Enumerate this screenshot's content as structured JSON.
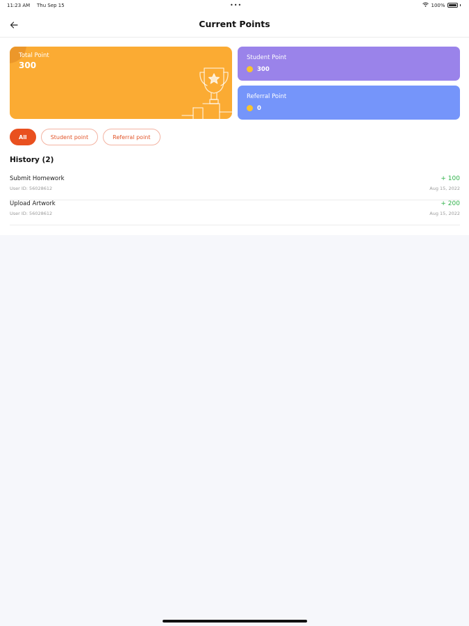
{
  "status_bar": {
    "time": "11:23 AM",
    "date": "Thu Sep 15",
    "dots": "•••",
    "battery": "100%"
  },
  "header": {
    "title": "Current Points",
    "back_icon": "arrow-left-icon"
  },
  "cards": {
    "total": {
      "label": "Total Point",
      "value": "300",
      "color": "#fbab33",
      "icon": "trophy-icon"
    },
    "student": {
      "label": "Student Point",
      "value": "300",
      "color": "#9a83ea",
      "icon": "coin-icon"
    },
    "referral": {
      "label": "Referral Point",
      "value": "0",
      "color": "#7595fa",
      "icon": "coin-icon"
    }
  },
  "filters": [
    {
      "label": "All",
      "active": true
    },
    {
      "label": "Student point",
      "active": false
    },
    {
      "label": "Referral point",
      "active": false
    }
  ],
  "history": {
    "title": "History (2)",
    "items": [
      {
        "name": "Submit Homework",
        "user_id": "User ID: 56028612",
        "points": "+ 100",
        "date": "Aug 15, 2022"
      },
      {
        "name": "Upload Artwork",
        "user_id": "User ID: 56028612",
        "points": "+ 200",
        "date": "Aug 15, 2022"
      }
    ]
  },
  "colors": {
    "accent": "#e9501f",
    "positive": "#2fb24a"
  }
}
